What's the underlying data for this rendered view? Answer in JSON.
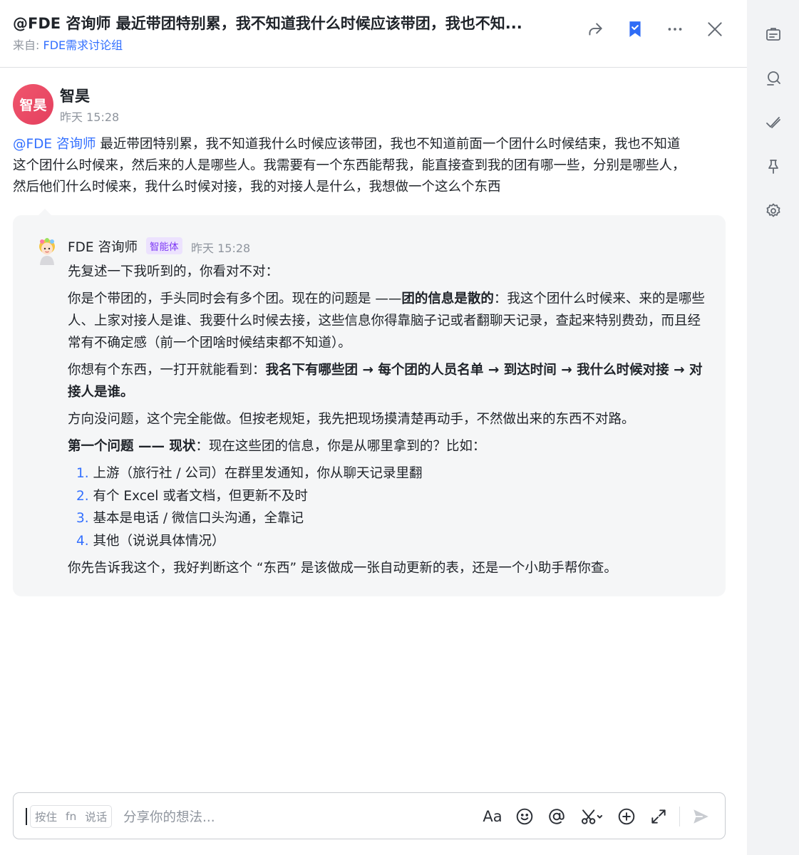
{
  "header": {
    "title": "@FDE 咨询师 最近带团特别累，我不知道我什么时候应该带团，我也不知...",
    "source_prefix": "来自:",
    "source_group": "FDE需求讨论组"
  },
  "message": {
    "avatar_text": "智昊",
    "author": "智昊",
    "time": "昨天 15:28",
    "mention": "@FDE 咨询师",
    "text": " 最近带团特别累，我不知道我什么时候应该带团，我也不知道前面一个团什么时候结束，我也不知道这个团什么时候来，然后来的人是哪些人。我需要有一个东西能帮我，能直接查到我的团有哪一些，分别是哪些人，然后他们什么时候来，我什么时候对接，我的对接人是什么，我想做一个这么个东西"
  },
  "reply": {
    "bot_name": "FDE 咨询师",
    "badge": "智能体",
    "time": "昨天 15:28",
    "p1": "先复述一下我听到的，你看对不对：",
    "p2_a": "你是个带团的，手头同时会有多个团。现在的问题是 ——",
    "p2_b": "团的信息是散的",
    "p2_c": "：我这个团什么时候来、来的是哪些人、上家对接人是谁、我要什么时候去接，这些信息你得靠脑子记或者翻聊天记录，查起来特别费劲，而且经常有不确定感（前一个团啥时候结束都不知道）。",
    "p3_a": "你想有个东西，一打开就能看到：",
    "p3_b": "我名下有哪些团 → 每个团的人员名单 → 到达时间 → 我什么时候对接 → 对接人是谁。",
    "p4": "方向没问题，这个完全能做。但按老规矩，我先把现场摸清楚再动手，不然做出来的东西不对路。",
    "p5_a": "第一个问题 —— 现状",
    "p5_b": "：现在这些团的信息，你是从哪里拿到的？比如：",
    "options": [
      {
        "num": "1.",
        "text": "上游（旅行社 / 公司）在群里发通知，你从聊天记录里翻"
      },
      {
        "num": "2.",
        "text": "有个 Excel 或者文档，但更新不及时"
      },
      {
        "num": "3.",
        "text": "基本是电话 / 微信口头沟通，全靠记"
      },
      {
        "num": "4.",
        "text": "其他（说说具体情况）"
      }
    ],
    "p6": "你先告诉我这个，我好判断这个 “东西” 是该做成一张自动更新的表，还是一个小助手帮你查。"
  },
  "composer": {
    "voice_hold": "按住",
    "voice_key": "fn",
    "voice_speak": "说话",
    "placeholder": "分享你的想法...",
    "format_label": "Aa"
  },
  "icons": [
    "share-icon",
    "bookmark-icon",
    "more-icon",
    "close-icon",
    "announcement-icon",
    "search-icon",
    "check-icon",
    "pin-icon",
    "settings-icon",
    "emoji-icon",
    "mention-icon",
    "scissors-icon",
    "add-icon",
    "expand-icon",
    "send-icon"
  ],
  "colors": {
    "accent": "#3370ff",
    "badge": "#7f3bf5",
    "bookmark": "#2f6cf6",
    "avatar": "#e94b64"
  }
}
